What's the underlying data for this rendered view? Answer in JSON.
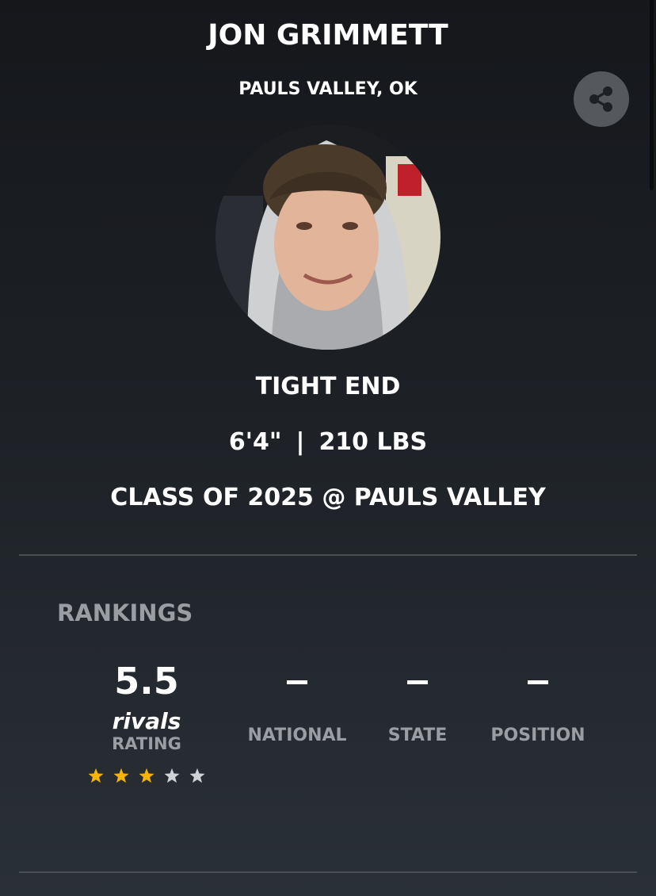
{
  "player": {
    "name": "JON GRIMMETT",
    "hometown": "PAULS VALLEY, OK",
    "position": "TIGHT END",
    "height": "6'4\"",
    "separator": "|",
    "weight": "210 LBS",
    "class_line": "CLASS OF 2025 @ PAULS VALLEY"
  },
  "share": {
    "icon": "share-icon"
  },
  "photo": {
    "description_icon": "player-headshot"
  },
  "rankings": {
    "heading": "RANKINGS",
    "rating": {
      "value": "5.5",
      "brand": "rivals",
      "label": "RATING",
      "stars_total": 5,
      "stars_filled": 3,
      "star_color_filled": "#f5b400",
      "star_color_empty": "#cfd2d6"
    },
    "columns": [
      {
        "value": "–",
        "label": "NATIONAL"
      },
      {
        "value": "–",
        "label": "STATE"
      },
      {
        "value": "–",
        "label": "POSITION"
      }
    ]
  },
  "colors": {
    "background_top": "#15171b",
    "background_bottom": "#2a3037",
    "muted_text": "#9a9da2",
    "divider": "#4a4f56"
  }
}
